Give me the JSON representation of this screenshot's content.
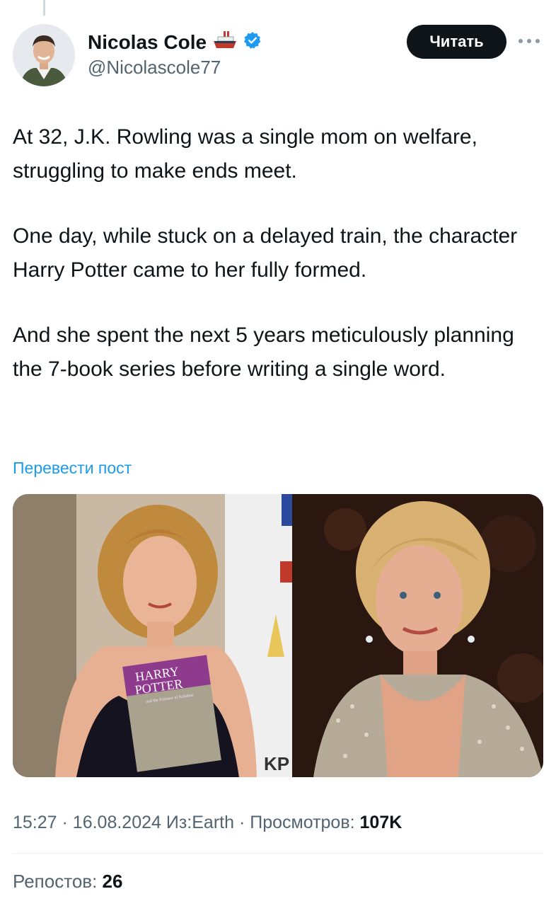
{
  "author": {
    "name": "Nicolas Cole",
    "handle": "@Nicolascole77",
    "emoji_icon": "ship-icon",
    "verified_icon": "verified-badge-icon"
  },
  "follow_button": {
    "label": "Читать"
  },
  "more_icon": "more-dots-icon",
  "tweet": {
    "paragraphs": [
      "At 32, J.K. Rowling was a single mom on welfare, struggling to make ends meet.",
      "One day, while stuck on a delayed train, the character Harry Potter came to her fully formed.",
      "And she spent the next 5 years meticulously planning the 7-book series before writing a single word."
    ]
  },
  "translate_link": "Перевести пост",
  "media": {
    "book_title_line1": "HARRY",
    "book_title_line2": "POTTER",
    "book_subtitle": "and the Prisoner of Azkaban",
    "sign_text": "KP"
  },
  "meta": {
    "time": "15:27",
    "date": "16.08.2024",
    "source": "Из:Earth",
    "views_label": "Просмотров:",
    "views_value": "107K",
    "sep": "·"
  },
  "stats": {
    "reposts_label": "Репостов:",
    "reposts_value": "26"
  },
  "colors": {
    "accent": "#1d9bf0",
    "text": "#0f1419",
    "secondary": "#536471",
    "button_bg": "#0f1419"
  }
}
